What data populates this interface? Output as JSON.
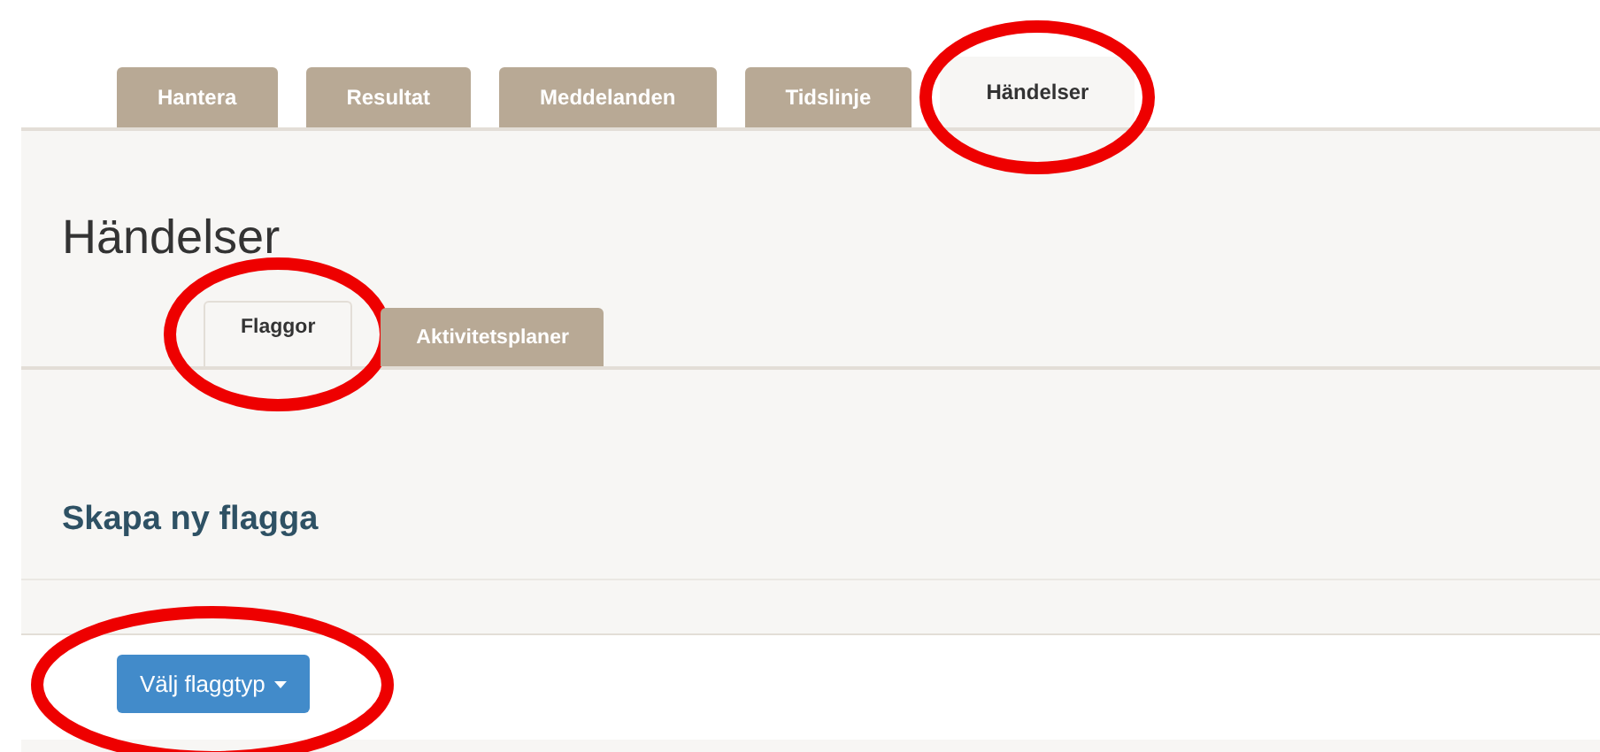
{
  "tabs": [
    {
      "label": "Hantera",
      "selected": false,
      "circled": false
    },
    {
      "label": "Resultat",
      "selected": false,
      "circled": false
    },
    {
      "label": "Meddelanden",
      "selected": false,
      "circled": false
    },
    {
      "label": "Tidslinje",
      "selected": false,
      "circled": false
    },
    {
      "label": "Händelser",
      "selected": true,
      "circled": true
    }
  ],
  "heading": "Händelser",
  "subtabs": [
    {
      "label": "Flaggor",
      "selected": true,
      "circled": true
    },
    {
      "label": "Aktivitetsplaner",
      "selected": false,
      "circled": false
    }
  ],
  "section": {
    "title": "Skapa ny flagga",
    "button": {
      "label": "Välj flaggtyp",
      "circled": true
    }
  }
}
